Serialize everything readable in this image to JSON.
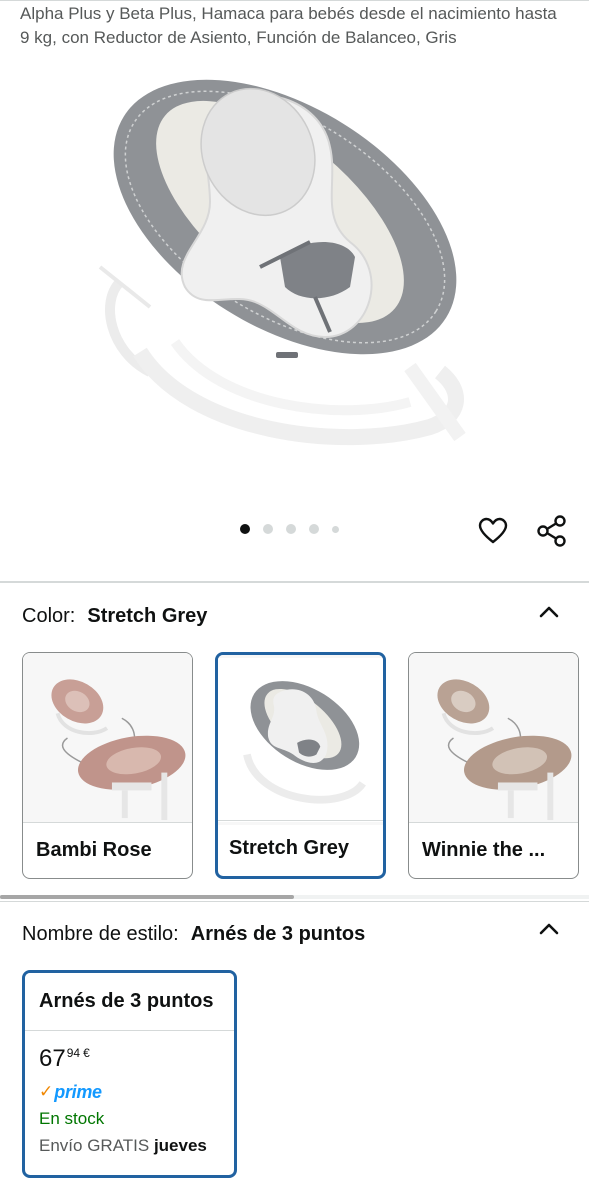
{
  "product": {
    "title": "Alpha Plus y Beta Plus, Hamaca para bebés desde el nacimiento hasta 9 kg, con Reductor de Asiento, Función de Balanceo, Gris"
  },
  "gallery": {
    "image_count": 5,
    "active_index": 0,
    "wishlist_icon": "heart-icon",
    "share_icon": "share-icon"
  },
  "color": {
    "label": "Color:",
    "selected": "Stretch Grey",
    "expanded": true,
    "options": [
      {
        "label": "Bambi Rose",
        "selected": false
      },
      {
        "label": "Stretch Grey",
        "selected": true
      },
      {
        "label": "Winnie the ...",
        "selected": false
      }
    ]
  },
  "style": {
    "label": "Nombre de estilo:",
    "selected": "Arnés de 3 puntos",
    "expanded": true,
    "card": {
      "name": "Arnés de 3 puntos",
      "price_whole": "67",
      "price_fraction": "94",
      "currency": "€",
      "prime_check": "✓",
      "prime_label": "prime",
      "stock": "En stock",
      "shipping_prefix": "Envío GRATIS",
      "shipping_day": "jueves"
    }
  },
  "colors": {
    "accent_border": "#2162a1",
    "in_stock": "#007600",
    "prime_blue": "#1399ff",
    "prime_check": "#f08804"
  }
}
